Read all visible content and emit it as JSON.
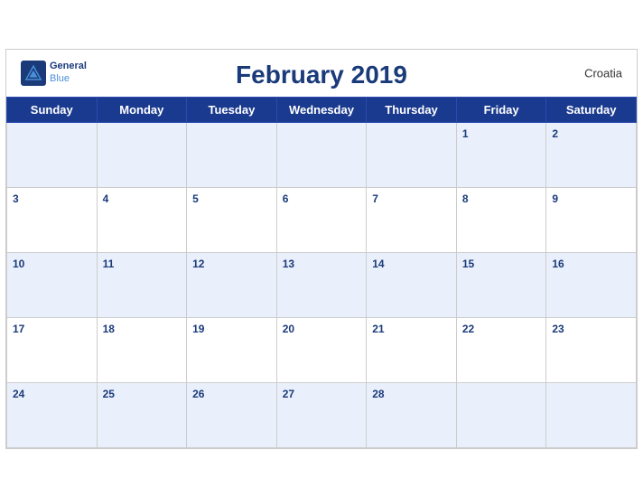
{
  "header": {
    "title": "February 2019",
    "country": "Croatia",
    "logo_general": "General",
    "logo_blue": "Blue"
  },
  "weekdays": [
    "Sunday",
    "Monday",
    "Tuesday",
    "Wednesday",
    "Thursday",
    "Friday",
    "Saturday"
  ],
  "weeks": [
    [
      null,
      null,
      null,
      null,
      null,
      1,
      2
    ],
    [
      3,
      4,
      5,
      6,
      7,
      8,
      9
    ],
    [
      10,
      11,
      12,
      13,
      14,
      15,
      16
    ],
    [
      17,
      18,
      19,
      20,
      21,
      22,
      23
    ],
    [
      24,
      25,
      26,
      27,
      28,
      null,
      null
    ]
  ],
  "colors": {
    "header_bg": "#1a3a8f",
    "header_text": "#ffffff",
    "title_color": "#1a3a7a",
    "row_odd_bg": "#eaf0fb",
    "row_even_bg": "#ffffff",
    "day_num_color": "#1a3a7a"
  }
}
